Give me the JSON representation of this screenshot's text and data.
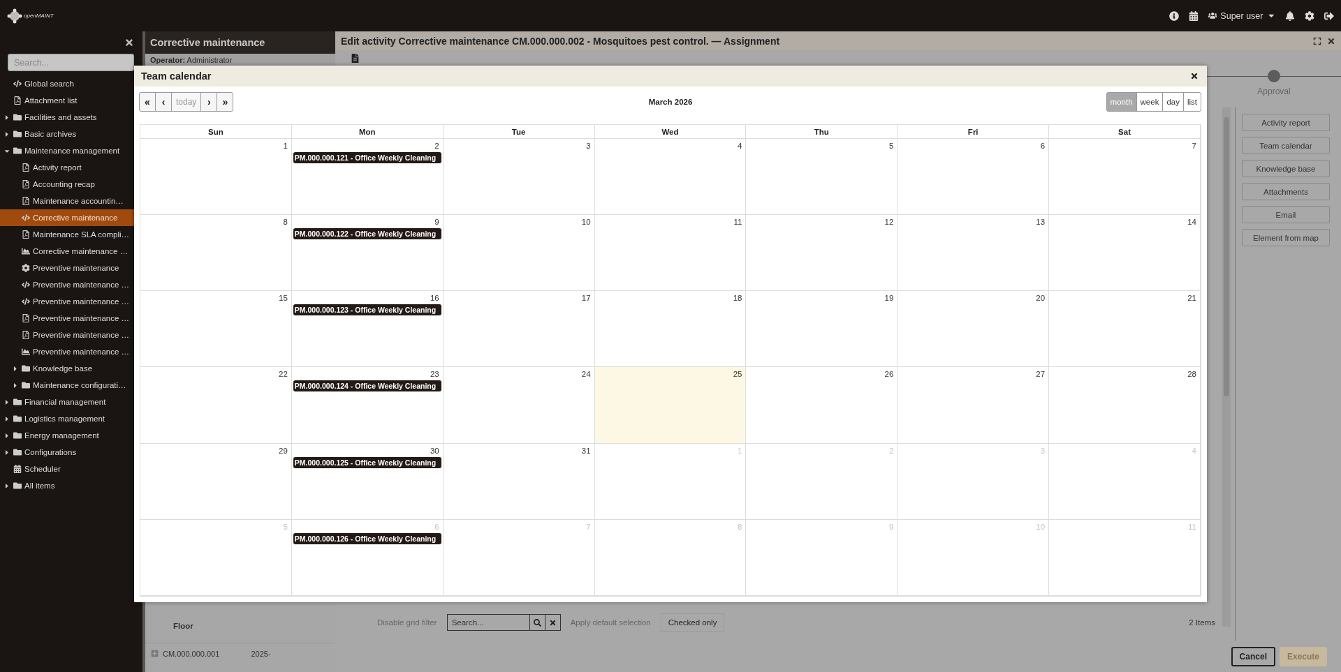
{
  "topbar": {
    "logo": "openMAINT",
    "user": "Super user"
  },
  "sidebar": {
    "search": {
      "placeholder": "Search..."
    },
    "nav": [
      {
        "label": "Global search",
        "kind": "script",
        "selected": false
      },
      {
        "label": "Attachment list",
        "kind": "report",
        "selected": false
      },
      {
        "label": "Facilities and assets",
        "kind": "folder",
        "expanded": false,
        "selected": false
      },
      {
        "label": "Basic archives",
        "kind": "folder",
        "expanded": false,
        "selected": false
      },
      {
        "label": "Maintenance management",
        "kind": "folder",
        "expanded": true,
        "selected": false,
        "children": [
          {
            "label": "Activity report",
            "kind": "report",
            "selected": false
          },
          {
            "label": "Accounting recap",
            "kind": "report",
            "selected": false
          },
          {
            "label": "Maintenance accountin…",
            "kind": "report",
            "selected": false
          },
          {
            "label": "Corrective maintenance",
            "kind": "script",
            "selected": true
          },
          {
            "label": "Maintenance SLA compli…",
            "kind": "report",
            "selected": false
          },
          {
            "label": "Corrective maintenance …",
            "kind": "chart",
            "selected": false
          },
          {
            "label": "Preventive maintenance",
            "kind": "gear",
            "selected": false
          },
          {
            "label": "Preventive maintenance …",
            "kind": "script",
            "selected": false
          },
          {
            "label": "Preventive maintenance …",
            "kind": "script",
            "selected": false
          },
          {
            "label": "Preventive maintenance …",
            "kind": "report",
            "selected": false
          },
          {
            "label": "Preventive maintenance …",
            "kind": "report",
            "selected": false
          },
          {
            "label": "Preventive maintenance …",
            "kind": "chart",
            "selected": false
          },
          {
            "label": "Knowledge base",
            "kind": "folder",
            "expanded": false,
            "selected": false
          },
          {
            "label": "Maintenance configurati…",
            "kind": "folder",
            "expanded": false,
            "selected": false
          }
        ]
      },
      {
        "label": "Financial management",
        "kind": "folder",
        "expanded": false,
        "selected": false
      },
      {
        "label": "Logistics management",
        "kind": "folder",
        "expanded": false,
        "selected": false
      },
      {
        "label": "Energy management",
        "kind": "folder",
        "expanded": false,
        "selected": false
      },
      {
        "label": "Configurations",
        "kind": "folder",
        "expanded": false,
        "selected": false
      },
      {
        "label": "Scheduler",
        "kind": "calendar",
        "selected": false
      },
      {
        "label": "All items",
        "kind": "folder",
        "expanded": false,
        "selected": false
      }
    ]
  },
  "list_panel": {
    "title": "Corrective maintenance",
    "operator": "**Operator:** Administrator",
    "floor_label": "Floor",
    "row": [
      "CM.000.000.001",
      "2025-"
    ]
  },
  "edit_window": {
    "title": "Edit activity Corrective maintenance CM.000.000.002 - Mosquitoes pest control. — Assignment",
    "step": "Approval",
    "actions": [
      "Activity report",
      "Team calendar",
      "Knowledge base",
      "Attachments",
      "Email",
      "Element from map"
    ],
    "grid_toolbar": {
      "filter_toggle": "Disable grid filter",
      "search_placeholder": "Search...",
      "default_selection": "Apply default selection",
      "checked_only": "Checked only",
      "count": "2 Items"
    },
    "footer": [
      {
        "label": "Cancel",
        "disabled": false
      },
      {
        "label": "Execute",
        "disabled": true
      }
    ]
  },
  "calendar": {
    "title": "Team calendar",
    "month": "March 2026",
    "nav": [
      {
        "label": "«",
        "disabled": false
      },
      {
        "label": "‹",
        "disabled": false
      },
      {
        "label": "today",
        "disabled": true
      },
      {
        "label": "›",
        "disabled": false
      },
      {
        "label": "»",
        "disabled": false
      }
    ],
    "views": [
      {
        "label": "month",
        "selected": true
      },
      {
        "label": "week",
        "selected": false
      },
      {
        "label": "day",
        "selected": false
      },
      {
        "label": "list",
        "selected": false
      }
    ],
    "weekdays": [
      "Sun",
      "Mon",
      "Tue",
      "Wed",
      "Thu",
      "Fri",
      "Sat"
    ],
    "weeks": [
      [
        {
          "day": "1",
          "outside": false,
          "today": false
        },
        {
          "day": "2",
          "outside": false,
          "today": false,
          "events": [
            "PM.000.000.121 - Office Weekly Cleaning"
          ]
        },
        {
          "day": "3",
          "outside": false,
          "today": false
        },
        {
          "day": "4",
          "outside": false,
          "today": false
        },
        {
          "day": "5",
          "outside": false,
          "today": false
        },
        {
          "day": "6",
          "outside": false,
          "today": false
        },
        {
          "day": "7",
          "outside": false,
          "today": false
        }
      ],
      [
        {
          "day": "8",
          "outside": false,
          "today": false
        },
        {
          "day": "9",
          "outside": false,
          "today": false,
          "events": [
            "PM.000.000.122 - Office Weekly Cleaning"
          ]
        },
        {
          "day": "10",
          "outside": false,
          "today": false
        },
        {
          "day": "11",
          "outside": false,
          "today": false
        },
        {
          "day": "12",
          "outside": false,
          "today": false
        },
        {
          "day": "13",
          "outside": false,
          "today": false
        },
        {
          "day": "14",
          "outside": false,
          "today": false
        }
      ],
      [
        {
          "day": "15",
          "outside": false,
          "today": false
        },
        {
          "day": "16",
          "outside": false,
          "today": false,
          "events": [
            "PM.000.000.123 - Office Weekly Cleaning"
          ]
        },
        {
          "day": "17",
          "outside": false,
          "today": false
        },
        {
          "day": "18",
          "outside": false,
          "today": false
        },
        {
          "day": "19",
          "outside": false,
          "today": false
        },
        {
          "day": "20",
          "outside": false,
          "today": false
        },
        {
          "day": "21",
          "outside": false,
          "today": false
        }
      ],
      [
        {
          "day": "22",
          "outside": false,
          "today": false
        },
        {
          "day": "23",
          "outside": false,
          "today": false,
          "events": [
            "PM.000.000.124 - Office Weekly Cleaning"
          ]
        },
        {
          "day": "24",
          "outside": false,
          "today": false
        },
        {
          "day": "25",
          "outside": false,
          "today": true
        },
        {
          "day": "26",
          "outside": false,
          "today": false
        },
        {
          "day": "27",
          "outside": false,
          "today": false
        },
        {
          "day": "28",
          "outside": false,
          "today": false
        }
      ],
      [
        {
          "day": "29",
          "outside": false,
          "today": false
        },
        {
          "day": "30",
          "outside": false,
          "today": false,
          "events": [
            "PM.000.000.125 - Office Weekly Cleaning"
          ]
        },
        {
          "day": "31",
          "outside": false,
          "today": false
        },
        {
          "day": "1",
          "outside": true,
          "today": false
        },
        {
          "day": "2",
          "outside": true,
          "today": false
        },
        {
          "day": "3",
          "outside": true,
          "today": false
        },
        {
          "day": "4",
          "outside": true,
          "today": false
        }
      ],
      [
        {
          "day": "5",
          "outside": true,
          "today": false
        },
        {
          "day": "6",
          "outside": true,
          "today": false,
          "events": [
            "PM.000.000.126 - Office Weekly Cleaning"
          ]
        },
        {
          "day": "7",
          "outside": true,
          "today": false
        },
        {
          "day": "8",
          "outside": true,
          "today": false
        },
        {
          "day": "9",
          "outside": true,
          "today": false
        },
        {
          "day": "10",
          "outside": true,
          "today": false
        },
        {
          "day": "11",
          "outside": true,
          "today": false
        }
      ]
    ]
  }
}
